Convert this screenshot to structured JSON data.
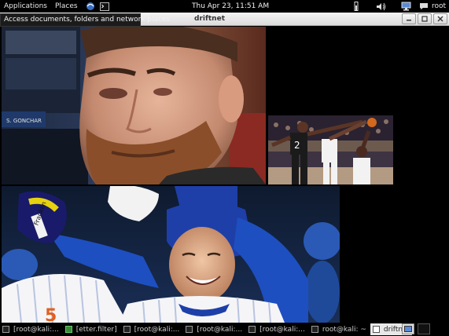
{
  "top_panel": {
    "applications": "Applications",
    "places": "Places",
    "clock": "Thu Apr 23, 11:51 AM",
    "user": "root"
  },
  "tooltip": "Access documents, folders and network places",
  "window": {
    "title": "driftnet"
  },
  "images": [
    {
      "name": "bearded-player",
      "label": "S. GONCHAR"
    },
    {
      "name": "basketball-game",
      "label": ""
    },
    {
      "name": "baseball-celebration",
      "label": ""
    }
  ],
  "taskbar": {
    "tasks": [
      {
        "label": "[root@kali:..."
      },
      {
        "label": "[etter.filter]"
      },
      {
        "label": "[root@kali:..."
      },
      {
        "label": "[root@kali:..."
      },
      {
        "label": "[root@kali:..."
      },
      {
        "label": "root@kali: ~"
      },
      {
        "label": "driftnet"
      }
    ]
  },
  "colors": {
    "panel": "#000000",
    "titlebar": "#e6e6e6",
    "accent": "#3465a4"
  }
}
